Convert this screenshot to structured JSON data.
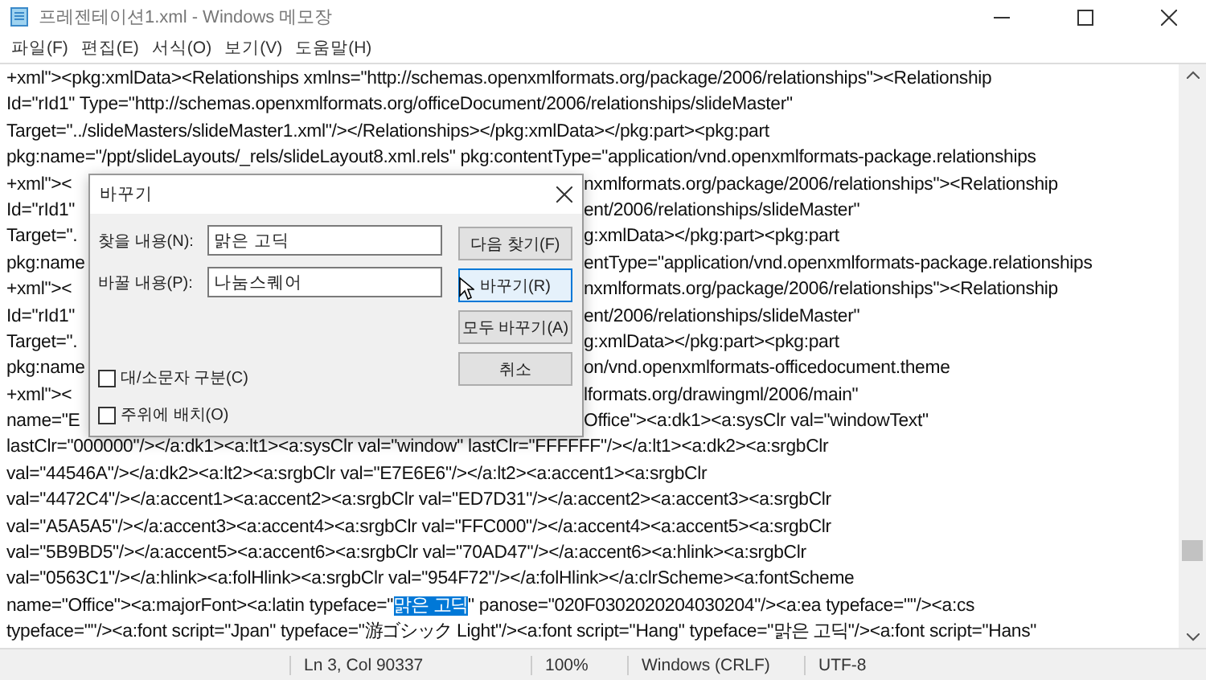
{
  "window": {
    "title": "프레젠테이션1.xml - Windows 메모장"
  },
  "menu": [
    "파일(F)",
    "편집(E)",
    "서식(O)",
    "보기(V)",
    "도움말(H)"
  ],
  "editor": {
    "lines": [
      {
        "text": "+xml\"><pkg:xmlData><Relationships xmlns=\"http://schemas.openxmlformats.org/package/2006/relationships\"><Relationship"
      },
      {
        "text": "Id=\"rId1\" Type=\"http://schemas.openxmlformats.org/officeDocument/2006/relationships/slideMaster\""
      },
      {
        "text": "Target=\"../slideMasters/slideMaster1.xml\"/></Relationships></pkg:xmlData></pkg:part><pkg:part"
      },
      {
        "text": "pkg:name=\"/ppt/slideLayouts/_rels/slideLayout8.xml.rels\" pkg:contentType=\"application/vnd.openxmlformats-package.relationships"
      },
      {
        "left": "+xml\"><",
        "right": "nxmlformats.org/package/2006/relationships\"><Relationship"
      },
      {
        "left": "Id=\"rId1\"",
        "right": "ent/2006/relationships/slideMaster\""
      },
      {
        "left": "Target=\".",
        "right": "g:xmlData></pkg:part><pkg:part"
      },
      {
        "left": "pkg:name",
        "right": "entType=\"application/vnd.openxmlformats-package.relationships"
      },
      {
        "left": "+xml\"><",
        "right": "nxmlformats.org/package/2006/relationships\"><Relationship"
      },
      {
        "left": "Id=\"rId1\"",
        "right": "ent/2006/relationships/slideMaster\""
      },
      {
        "left": "Target=\".",
        "right": "g:xmlData></pkg:part><pkg:part"
      },
      {
        "left": "pkg:name",
        "right": "on/vnd.openxmlformats-officedocument.theme"
      },
      {
        "left": "+xml\"><",
        "right": "lformats.org/drawingml/2006/main\""
      },
      {
        "left": "name=\"E",
        "right": "Office\"><a:dk1><a:sysClr val=\"windowText\""
      },
      {
        "text": "lastClr=\"000000\"/></a:dk1><a:lt1><a:sysClr val=\"window\" lastClr=\"FFFFFF\"/></a:lt1><a:dk2><a:srgbClr"
      },
      {
        "text": "val=\"44546A\"/></a:dk2><a:lt2><a:srgbClr val=\"E7E6E6\"/></a:lt2><a:accent1><a:srgbClr"
      },
      {
        "text": "val=\"4472C4\"/></a:accent1><a:accent2><a:srgbClr val=\"ED7D31\"/></a:accent2><a:accent3><a:srgbClr"
      },
      {
        "text": "val=\"A5A5A5\"/></a:accent3><a:accent4><a:srgbClr val=\"FFC000\"/></a:accent4><a:accent5><a:srgbClr"
      },
      {
        "text": "val=\"5B9BD5\"/></a:accent5><a:accent6><a:srgbClr val=\"70AD47\"/></a:accent6><a:hlink><a:srgbClr"
      },
      {
        "text": "val=\"0563C1\"/></a:hlink><a:folHlink><a:srgbClr val=\"954F72\"/></a:folHlink></a:clrScheme><a:fontScheme"
      },
      {
        "spans": [
          {
            "text": "name=\"Office\"><a:majorFont><a:latin typeface=\"",
            "selected": false
          },
          {
            "text": "맑은 고딕",
            "selected": true
          },
          {
            "text": "\" panose=\"020F0302020204030204\"/><a:ea typeface=\"\"/><a:cs",
            "selected": false
          }
        ]
      },
      {
        "text": "typeface=\"\"/><a:font script=\"Jpan\" typeface=\"游ゴシック Light\"/><a:font script=\"Hang\" typeface=\"맑은 고딕\"/><a:font script=\"Hans\""
      }
    ]
  },
  "dialog": {
    "title": "바꾸기",
    "fields": [
      {
        "label": "찾을 내용(N):",
        "value": "맑은 고딕"
      },
      {
        "label": "바꿀 내용(P):",
        "value": "나눔스퀘어"
      }
    ],
    "buttons": [
      {
        "label": "다음 찾기(F)",
        "selected": false
      },
      {
        "label": "바꾸기(R)",
        "selected": true
      },
      {
        "label": "모두 바꾸기(A)",
        "selected": false
      },
      {
        "label": "취소",
        "selected": false
      }
    ],
    "options": [
      {
        "label": "대/소문자 구분(C)",
        "checked": false
      },
      {
        "label": "주위에 배치(O)",
        "checked": false
      }
    ]
  },
  "status_bar": [
    "Ln 3, Col 90337",
    "100%",
    "Windows (CRLF)",
    "UTF-8"
  ]
}
